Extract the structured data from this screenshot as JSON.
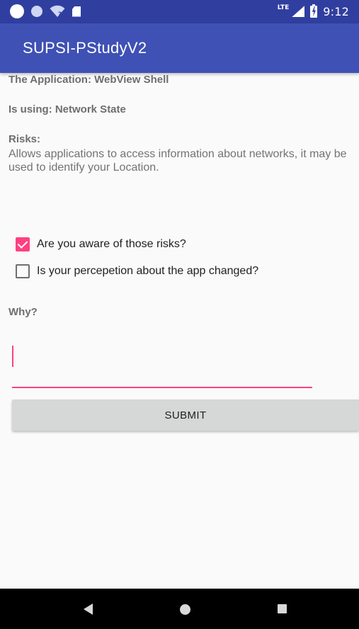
{
  "status_bar": {
    "network_label": "LTE",
    "time": "9:12",
    "icons": [
      "notification-circle-icon",
      "notification-dot-icon",
      "wifi-unknown-icon",
      "sd-card-icon",
      "cell-signal-icon",
      "battery-charging-icon"
    ]
  },
  "app_bar": {
    "title": "SUPSI-PStudyV2"
  },
  "content": {
    "application_label": "The Application: WebView Shell",
    "using_label": "Is using: Network State",
    "risks_label": "Risks:",
    "risks_text": "Allows applications to access information about networks, it may be used to identify your Location.",
    "checkboxes": [
      {
        "label": "Are you aware of those risks?",
        "checked": true
      },
      {
        "label": "Is your percepetion about the app changed?",
        "checked": false
      }
    ],
    "why_label": "Why?",
    "why_input_value": "",
    "submit_label": "SUBMIT"
  },
  "nav_bar": {
    "icons": [
      "back-icon",
      "home-icon",
      "recents-icon"
    ]
  },
  "colors": {
    "status_bar": "#303f9f",
    "app_bar": "#3f51b5",
    "accent": "#ff4081",
    "background": "#fafafa",
    "button": "#d6d7d7"
  }
}
